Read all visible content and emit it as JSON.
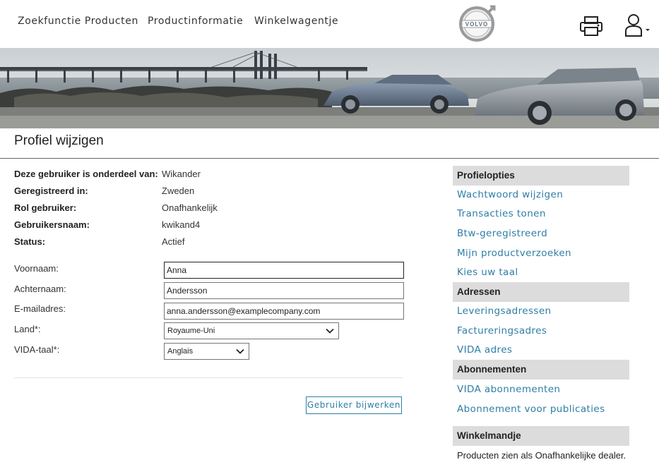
{
  "nav": {
    "items": [
      "Zoekfunctie Producten",
      "Productinformatie",
      "Winkelwagentje"
    ]
  },
  "logo": {
    "text": "VOLVO"
  },
  "header_icons": {
    "print": "printer-icon",
    "user": "user-icon"
  },
  "page": {
    "title": "Profiel wijzigen"
  },
  "info": [
    {
      "label": "Deze gebruiker is onderdeel van:",
      "value": "Wikander"
    },
    {
      "label": "Geregistreerd in:",
      "value": "Zweden"
    },
    {
      "label": "Rol gebruiker:",
      "value": "Onafhankelijk"
    },
    {
      "label": "Gebruikersnaam:",
      "value": "kwikand4"
    },
    {
      "label": "Status:",
      "value": "Actief"
    }
  ],
  "form": {
    "first_name_label": "Voornaam:",
    "first_name_value": "Anna",
    "last_name_label": "Achternaam:",
    "last_name_value": "Andersson",
    "email_label": "E-mailadres:",
    "email_value": "anna.andersson@examplecompany.com",
    "country_label": "Land*:",
    "country_value": "Royaume-Uni",
    "vida_lang_label": "VIDA-taal*:",
    "vida_lang_value": "Anglais",
    "update_button": "Gebruiker bijwerken"
  },
  "sidebar": {
    "profile_heading": "Profielopties",
    "profile_links": [
      "Wachtwoord wijzigen",
      "Transacties tonen",
      "Btw-geregistreerd",
      "Mijn productverzoeken",
      "Kies uw taal"
    ],
    "addresses_heading": "Adressen",
    "address_links": [
      "Leveringsadressen",
      "Factureringsadres",
      "VIDA adres"
    ],
    "subscriptions_heading": "Abonnementen",
    "subscription_links": [
      "VIDA abonnementen",
      "Abonnement voor publicaties"
    ],
    "cart_heading": "Winkelmandje",
    "cart_text": "Producten zien als Onafhankelijke dealer."
  },
  "colors": {
    "link": "#2e7ea6",
    "sidebar_heading_bg": "#dcdcdc"
  }
}
